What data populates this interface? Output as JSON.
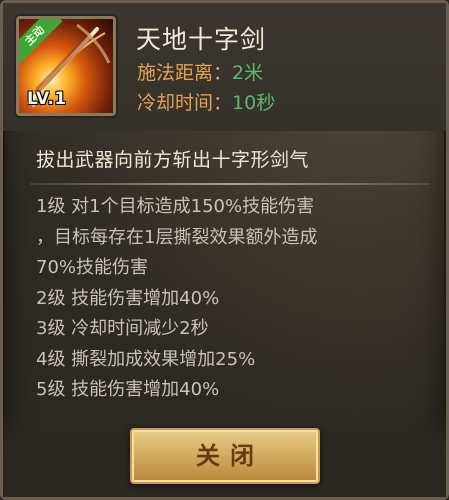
{
  "skill": {
    "name": "天地十字剑",
    "active_tag": "主动",
    "level": "LV.1",
    "icon": "sword-slash-icon",
    "range_label": "施法距离：",
    "range_value": "2米",
    "cooldown_label": "冷却时间：",
    "cooldown_value": "10秒",
    "description": "拔出武器向前方斩出十字形剑气"
  },
  "effects": [
    "1级 对1个目标造成150%技能伤害",
    "，目标每存在1层撕裂效果额外造成",
    "70%技能伤害",
    "2级 技能伤害增加40%",
    "3级 冷却时间减少2秒",
    "4级 撕裂加成效果增加25%",
    "5级 技能伤害增加40%"
  ],
  "buttons": {
    "close_label": "关闭"
  },
  "colors": {
    "label": "#e6a253",
    "value": "#5fb86a",
    "title": "#f3ead8",
    "button": "#d4ae62"
  }
}
